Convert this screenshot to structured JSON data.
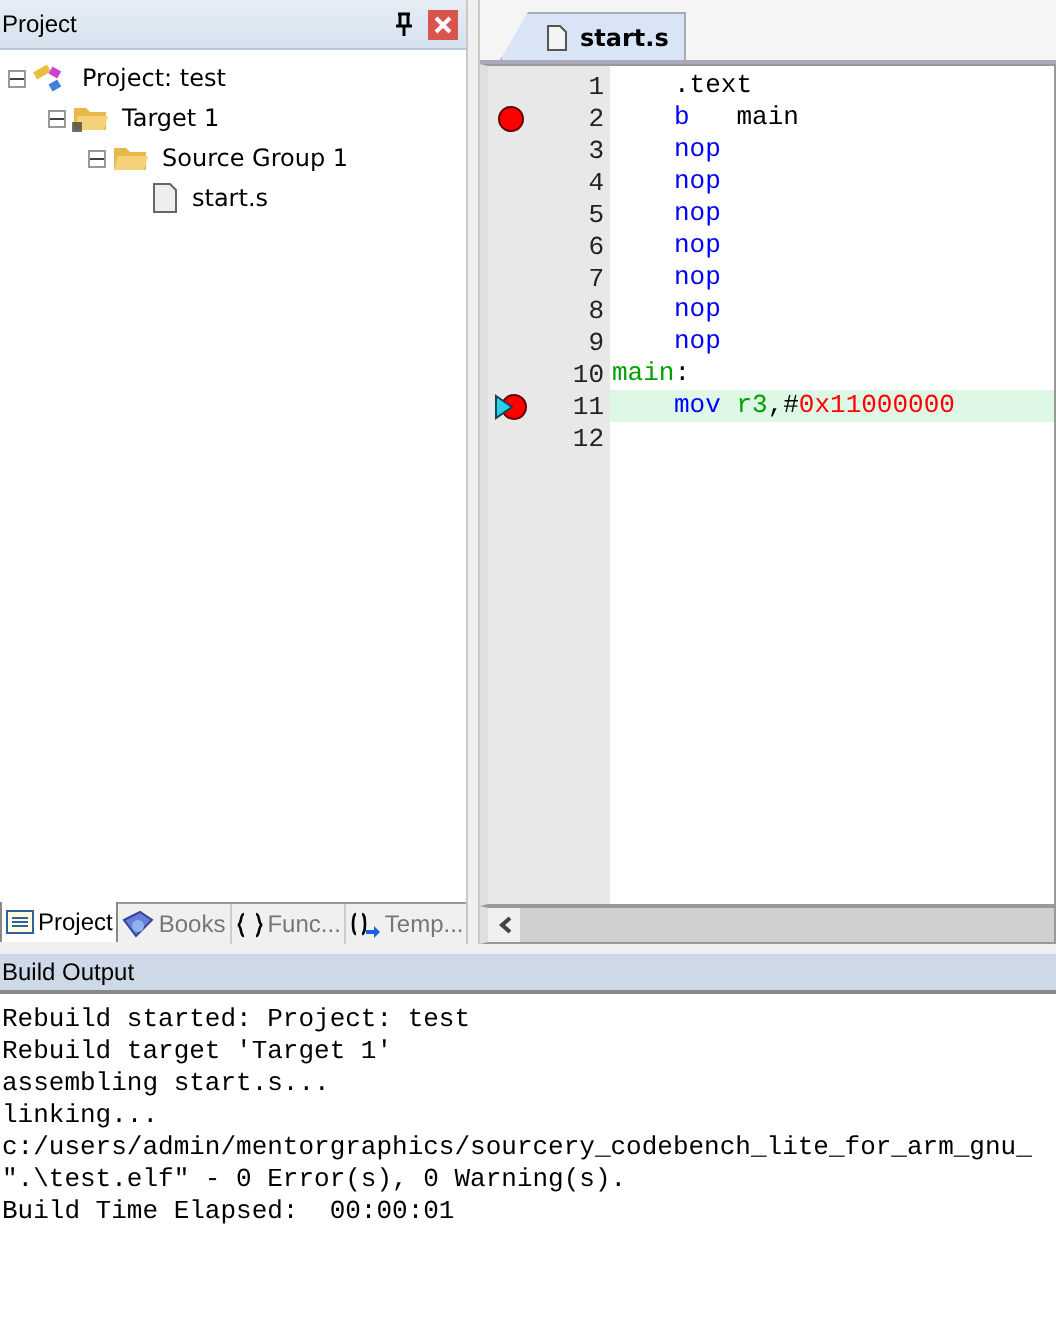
{
  "project_panel": {
    "title": "Project",
    "tree": [
      {
        "label": "Project: test",
        "kind": "project",
        "expanded": true,
        "children": [
          {
            "label": "Target 1",
            "kind": "target",
            "expanded": true,
            "children": [
              {
                "label": "Source Group 1",
                "kind": "group",
                "expanded": true,
                "children": [
                  {
                    "label": "start.s",
                    "kind": "file"
                  }
                ]
              }
            ]
          }
        ]
      }
    ],
    "tabs": [
      {
        "label": "Project",
        "kind": "project",
        "selected": true
      },
      {
        "label": "Books",
        "kind": "books",
        "selected": false
      },
      {
        "label": "Func...",
        "kind": "functions",
        "selected": false
      },
      {
        "label": "Temp...",
        "kind": "templates",
        "selected": false
      }
    ]
  },
  "editor": {
    "tabs": [
      {
        "label": "start.s",
        "selected": true
      }
    ],
    "lines": [
      {
        "number": "1",
        "indent": true,
        "breakpoint": false,
        "current": false,
        "highlighted": false,
        "tokens": [
          {
            "text": ".text",
            "kind": "plain"
          }
        ]
      },
      {
        "number": "2",
        "indent": true,
        "breakpoint": true,
        "current": false,
        "highlighted": false,
        "tokens": [
          {
            "text": "b",
            "kind": "keyword"
          },
          {
            "text": "   main",
            "kind": "plain"
          }
        ]
      },
      {
        "number": "3",
        "indent": true,
        "breakpoint": false,
        "current": false,
        "highlighted": false,
        "tokens": [
          {
            "text": "nop",
            "kind": "keyword"
          }
        ]
      },
      {
        "number": "4",
        "indent": true,
        "breakpoint": false,
        "current": false,
        "highlighted": false,
        "tokens": [
          {
            "text": "nop",
            "kind": "keyword"
          }
        ]
      },
      {
        "number": "5",
        "indent": true,
        "breakpoint": false,
        "current": false,
        "highlighted": false,
        "tokens": [
          {
            "text": "nop",
            "kind": "keyword"
          }
        ]
      },
      {
        "number": "6",
        "indent": true,
        "breakpoint": false,
        "current": false,
        "highlighted": false,
        "tokens": [
          {
            "text": "nop",
            "kind": "keyword"
          }
        ]
      },
      {
        "number": "7",
        "indent": true,
        "breakpoint": false,
        "current": false,
        "highlighted": false,
        "tokens": [
          {
            "text": "nop",
            "kind": "keyword"
          }
        ]
      },
      {
        "number": "8",
        "indent": true,
        "breakpoint": false,
        "current": false,
        "highlighted": false,
        "tokens": [
          {
            "text": "nop",
            "kind": "keyword"
          }
        ]
      },
      {
        "number": "9",
        "indent": true,
        "breakpoint": false,
        "current": false,
        "highlighted": false,
        "tokens": [
          {
            "text": "nop",
            "kind": "keyword"
          }
        ]
      },
      {
        "number": "10",
        "indent": false,
        "breakpoint": false,
        "current": false,
        "highlighted": false,
        "tokens": [
          {
            "text": "main",
            "kind": "label"
          },
          {
            "text": ":",
            "kind": "plain"
          }
        ]
      },
      {
        "number": "11",
        "indent": true,
        "breakpoint": true,
        "current": true,
        "highlighted": true,
        "tokens": [
          {
            "text": "mov",
            "kind": "keyword"
          },
          {
            "text": " r3",
            "kind": "register"
          },
          {
            "text": ",#",
            "kind": "plain"
          },
          {
            "text": "0x11000000",
            "kind": "number"
          }
        ]
      },
      {
        "number": "12",
        "breakpoint": false,
        "current": false,
        "highlighted": false
      }
    ]
  },
  "build_output": {
    "title": "Build Output",
    "lines": [
      "Rebuild started: Project: test",
      "Rebuild target 'Target 1'",
      "assembling start.s...",
      "linking...",
      "c:/users/admin/mentorgraphics/sourcery_codebench_lite_for_arm_gnu_",
      "\".\\test.elf\" - 0 Error(s), 0 Warning(s).",
      "Build Time Elapsed:  00:00:01"
    ]
  }
}
